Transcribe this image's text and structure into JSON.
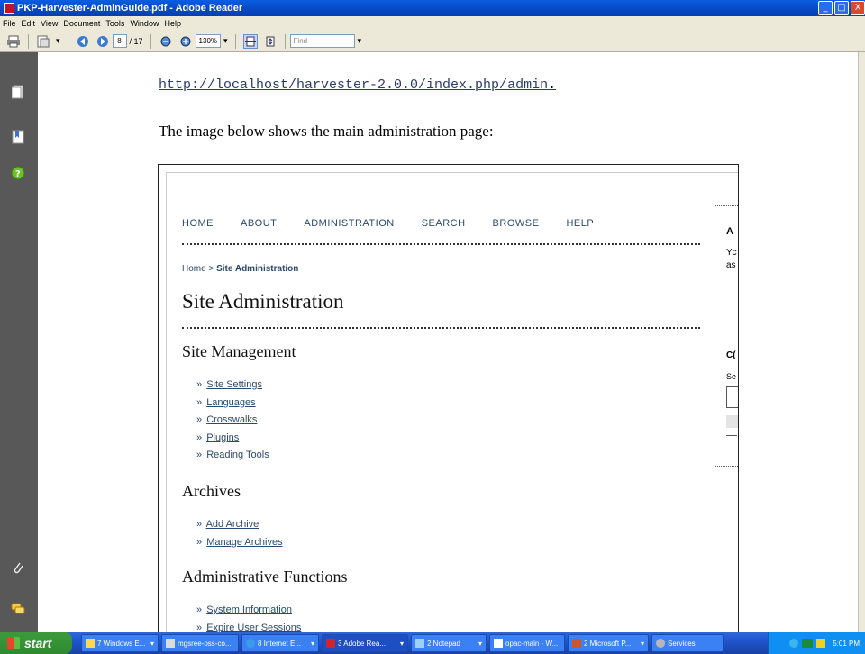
{
  "window": {
    "title": "PKP-Harvester-AdminGuide.pdf - Adobe Reader",
    "controls": [
      "_",
      "□",
      "X"
    ]
  },
  "menubar": [
    "File",
    "Edit",
    "View",
    "Document",
    "Tools",
    "Window",
    "Help"
  ],
  "toolbar": {
    "page_current": "8",
    "page_total": "/ 17",
    "zoom": "130%",
    "find_placeholder": "Find"
  },
  "document": {
    "url": "http://localhost/harvester-2.0.0/index.php/admin",
    "url_suffix": ".",
    "paragraph": "The image below shows the main administration page:"
  },
  "screenshot": {
    "nav": [
      "HOME",
      "ABOUT",
      "ADMINISTRATION",
      "SEARCH",
      "BROWSE",
      "HELP"
    ],
    "breadcrumb_home": "Home",
    "breadcrumb_sep": " > ",
    "breadcrumb_current": "Site Administration",
    "title": "Site Administration",
    "sections": [
      {
        "heading": "Site Management",
        "links": [
          "Site Settings",
          "Languages",
          "Crosswalks",
          "Plugins",
          "Reading Tools"
        ]
      },
      {
        "heading": "Archives",
        "links": [
          "Add Archive",
          "Manage Archives"
        ]
      },
      {
        "heading": "Administrative Functions",
        "links": [
          "System Information",
          "Expire User Sessions"
        ]
      }
    ],
    "bullet": "»",
    "sidebox": {
      "a": "A",
      "y1": "Yc",
      "y2": "as",
      "c": "C(",
      "s": "Se"
    }
  },
  "taskbar": {
    "start": "start",
    "tasks": [
      "7 Windows E...",
      "mgsree-oss-co...",
      "8 Internet E...",
      "3 Adobe Rea...",
      "2 Notepad",
      "opac-main - W...",
      "2 Microsoft P...",
      "Services"
    ],
    "clock": "5:01 PM"
  }
}
